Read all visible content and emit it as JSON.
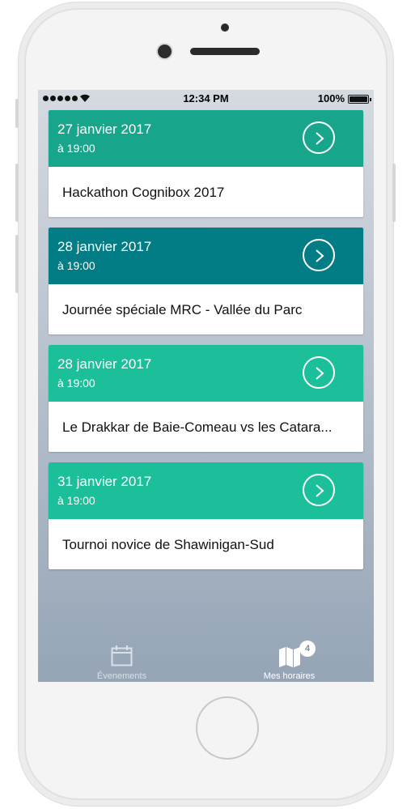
{
  "status_bar": {
    "time": "12:34 PM",
    "battery": "100%"
  },
  "events": [
    {
      "date": "27 janvier 2017",
      "time": "à 19:00",
      "title": "Hackathon Cognibox 2017",
      "color": "#17a58b"
    },
    {
      "date": "28 janvier 2017",
      "time": "à 19:00",
      "title": "Journée spéciale MRC - Vallée du Parc",
      "color": "#027d86"
    },
    {
      "date": "28 janvier 2017",
      "time": "à 19:00",
      "title": "Le Drakkar de Baie-Comeau vs les Catara...",
      "color": "#1bbf99"
    },
    {
      "date": "31 janvier 2017",
      "time": "à 19:00",
      "title": "Tournoi novice de Shawinigan-Sud",
      "color": "#1bbf99"
    }
  ],
  "tab_bar": {
    "events_label": "Évenements",
    "schedule_label": "Mes horaires",
    "schedule_badge": "4",
    "events_icon": "calendar-icon",
    "schedule_icon": "map-icon"
  }
}
